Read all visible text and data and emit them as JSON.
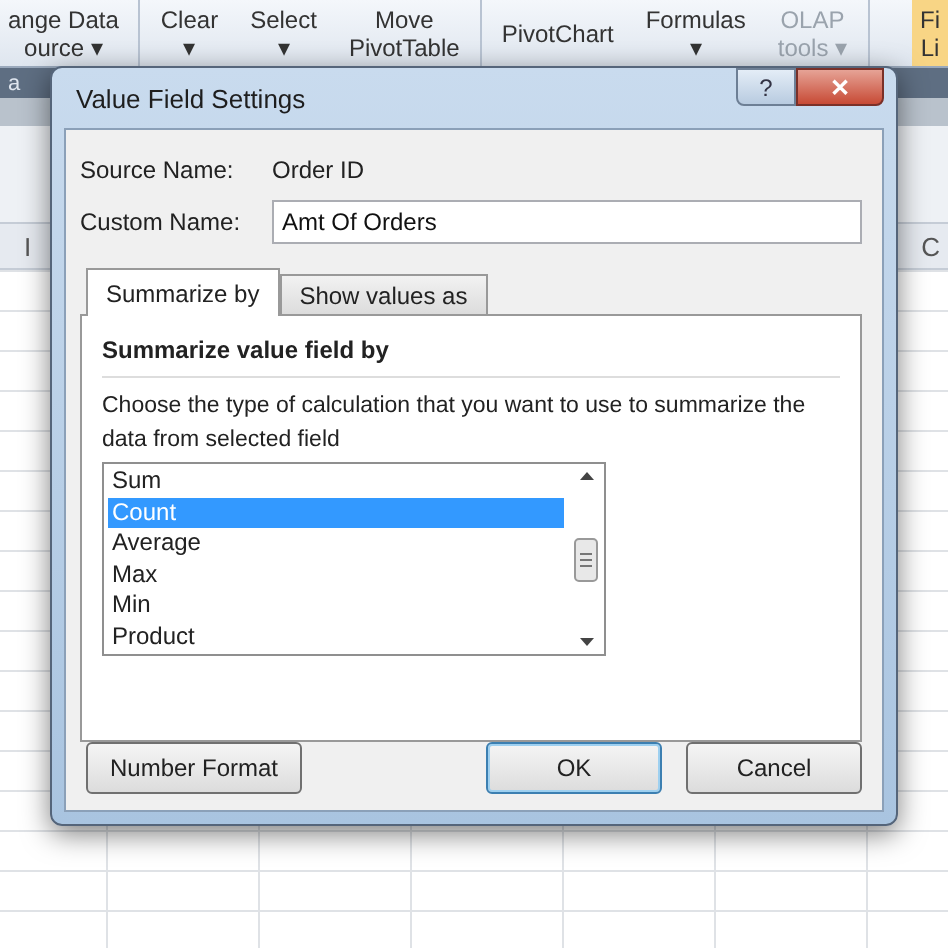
{
  "ribbon": {
    "groups": [
      {
        "buttons": [
          {
            "lines": [
              "ange Data",
              "ource ▾"
            ]
          }
        ]
      },
      {
        "buttons": [
          {
            "lines": [
              "Clear",
              "▾"
            ]
          },
          {
            "lines": [
              "Select",
              "▾"
            ]
          },
          {
            "lines": [
              "Move",
              "PivotTable"
            ]
          }
        ]
      },
      {
        "buttons": [
          {
            "lines": [
              "PivotChart"
            ]
          },
          {
            "lines": [
              "Formulas",
              "▾"
            ]
          },
          {
            "lines": [
              "OLAP",
              "tools ▾"
            ],
            "disabled": true
          }
        ]
      },
      {
        "buttons": [
          {
            "lines": [
              "Fi",
              "Li"
            ],
            "highlighted": true
          }
        ]
      }
    ]
  },
  "name_box": "a",
  "column_headers": [
    "I",
    "C"
  ],
  "dialog": {
    "title": "Value Field Settings",
    "help_button": "?",
    "close_button": "✕",
    "source_label": "Source Name:",
    "source_value": "Order ID",
    "custom_label": "Custom Name:",
    "custom_value": "Amt Of Orders",
    "tabs": [
      {
        "label": "Summarize by",
        "selected": true
      },
      {
        "label": "Show values as",
        "selected": false
      }
    ],
    "heading": "Summarize value field by",
    "description": "Choose the type of calculation that you want to use to summarize the data from selected field",
    "functions": [
      {
        "label": "Sum",
        "selected": false
      },
      {
        "label": "Count",
        "selected": true
      },
      {
        "label": "Average",
        "selected": false
      },
      {
        "label": "Max",
        "selected": false
      },
      {
        "label": "Min",
        "selected": false
      },
      {
        "label": "Product",
        "selected": false
      }
    ],
    "buttons": [
      {
        "label": "Number Format",
        "kind": "secondary"
      },
      {
        "label": "OK",
        "kind": "default"
      },
      {
        "label": "Cancel",
        "kind": "secondary"
      }
    ]
  }
}
